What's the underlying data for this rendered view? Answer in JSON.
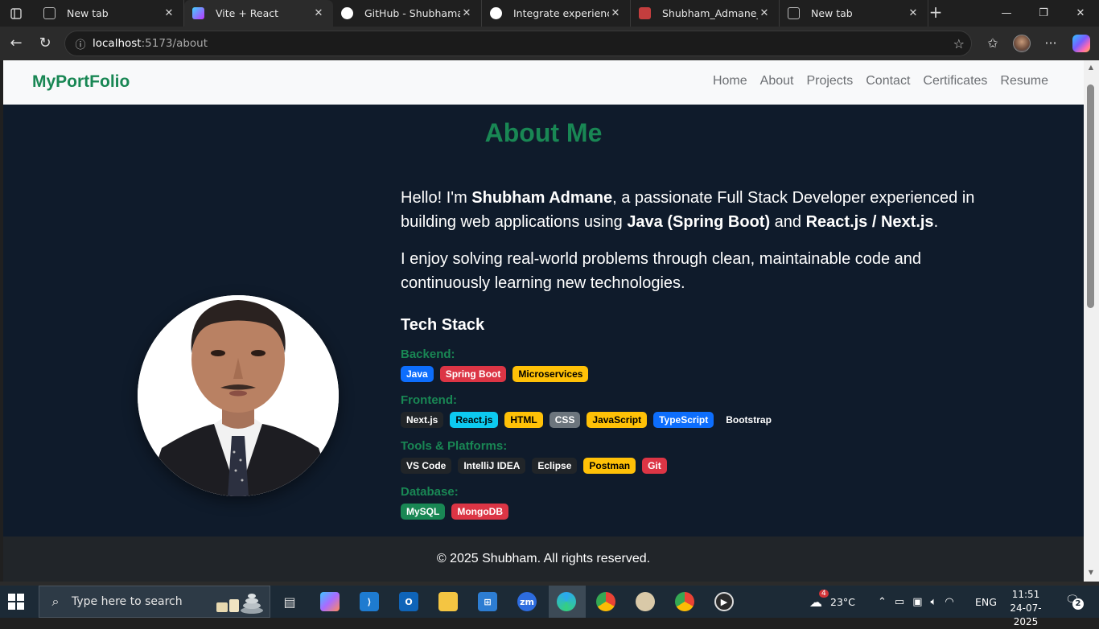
{
  "browser": {
    "tabs": [
      {
        "title": "New tab",
        "icon": "newtab-icon"
      },
      {
        "title": "Vite + React",
        "icon": "vite-icon",
        "active": true
      },
      {
        "title": "GitHub - Shubhamadm",
        "icon": "github-icon"
      },
      {
        "title": "Integrate experience se",
        "icon": "chatgpt-icon"
      },
      {
        "title": "Shubham_Admane_cv.p",
        "icon": "pdf-icon"
      },
      {
        "title": "New tab",
        "icon": "newtab-icon"
      }
    ],
    "address": {
      "host": "localhost",
      "path": ":5173/about"
    }
  },
  "site": {
    "brand": "MyPortFolio",
    "menu": [
      "Home",
      "About",
      "Projects",
      "Contact",
      "Certificates",
      "Resume"
    ],
    "about_title": "About Me",
    "intro": {
      "p1_a": "Hello! I'm ",
      "p1_name": "Shubham Admane",
      "p1_b": ", a passionate Full Stack Developer experienced in building web applications using ",
      "p1_tech1": "Java (Spring Boot)",
      "p1_c": " and ",
      "p1_tech2": "React.js / Next.js",
      "p1_d": ".",
      "p2": "I enjoy solving real-world problems through clean, maintainable code and continuously learning new technologies."
    },
    "tech_stack_title": "Tech Stack",
    "categories": [
      {
        "label": "Backend:",
        "badges": [
          {
            "text": "Java",
            "style": "blue"
          },
          {
            "text": "Spring Boot",
            "style": "red"
          },
          {
            "text": "Microservices",
            "style": "yellow"
          }
        ]
      },
      {
        "label": "Frontend:",
        "badges": [
          {
            "text": "Next.js",
            "style": "dark"
          },
          {
            "text": "React.js",
            "style": "cyan"
          },
          {
            "text": "HTML",
            "style": "yellow"
          },
          {
            "text": "CSS",
            "style": "gray"
          },
          {
            "text": "JavaScript",
            "style": "yellow"
          },
          {
            "text": "TypeScript",
            "style": "blue"
          },
          {
            "text": "Bootstrap",
            "style": "plain"
          }
        ]
      },
      {
        "label": "Tools & Platforms:",
        "badges": [
          {
            "text": "VS Code",
            "style": "dark"
          },
          {
            "text": "IntelliJ IDEA",
            "style": "dark"
          },
          {
            "text": "Eclipse",
            "style": "dark"
          },
          {
            "text": "Postman",
            "style": "yellow"
          },
          {
            "text": "Git",
            "style": "red"
          }
        ]
      },
      {
        "label": "Database:",
        "badges": [
          {
            "text": "MySQL",
            "style": "green"
          },
          {
            "text": "MongoDB",
            "style": "red"
          }
        ]
      }
    ],
    "footer": "© 2025 Shubham. All rights reserved."
  },
  "taskbar": {
    "search_placeholder": "Type here to search",
    "weather": "23°C",
    "weather_badge": "4",
    "language": "ENG",
    "time": "11:51",
    "date": "24-07-2025",
    "notifications": "2"
  }
}
